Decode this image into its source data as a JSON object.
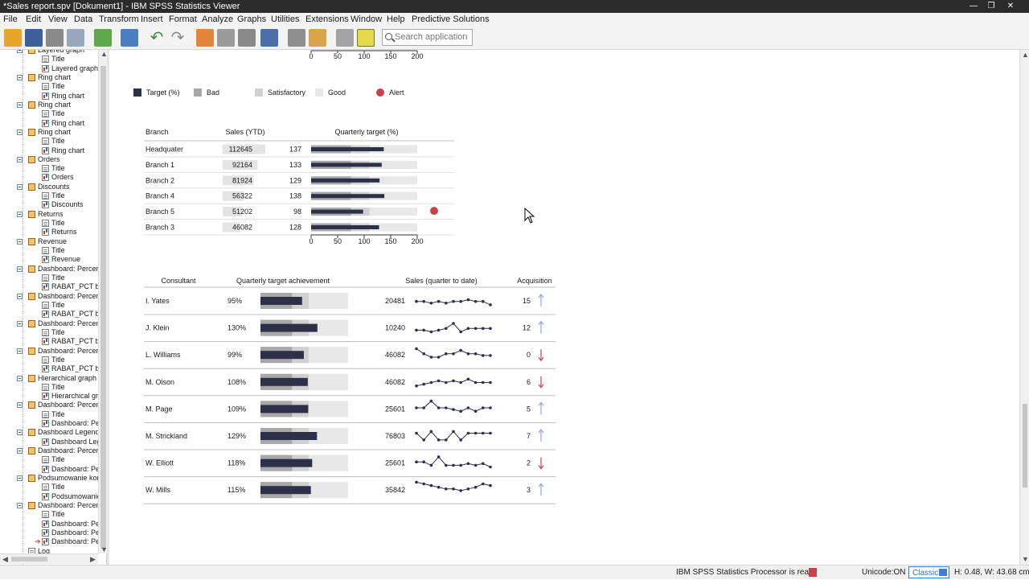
{
  "window": {
    "title": "*Sales report.spv [Dokument1] - IBM SPSS Statistics Viewer",
    "controls": [
      "—",
      "❐",
      "✕"
    ]
  },
  "menu": [
    "File",
    "Edit",
    "View",
    "Data",
    "Transform",
    "Insert",
    "Format",
    "Analyze",
    "Graphs",
    "Utilities",
    "Extensions",
    "Window",
    "Help",
    "Predictive Solutions"
  ],
  "toolbar": {
    "search_placeholder": "Search application",
    "icons": [
      "open-icon",
      "save-icon",
      "print-icon",
      "print-preview-icon",
      "export-icon",
      "recall-dialog-icon",
      "undo-icon",
      "redo-icon",
      "goto-data-icon",
      "goto-case-icon",
      "goto-variable-icon",
      "variables-icon",
      "designate-window-icon",
      "insert-output-icon",
      "hide-icon",
      "promote-icon",
      "demote-icon",
      "new-item-icon"
    ]
  },
  "outline": {
    "items": [
      {
        "level": 1,
        "type": "book",
        "label": "Layered graph"
      },
      {
        "level": 2,
        "type": "page",
        "label": "Title"
      },
      {
        "level": 2,
        "type": "graph",
        "label": "Layered graph"
      },
      {
        "level": 1,
        "type": "book",
        "label": "Ring chart"
      },
      {
        "level": 2,
        "type": "page",
        "label": "Title"
      },
      {
        "level": 2,
        "type": "graph",
        "label": "Ring chart"
      },
      {
        "level": 1,
        "type": "book",
        "label": "Ring chart"
      },
      {
        "level": 2,
        "type": "page",
        "label": "Title"
      },
      {
        "level": 2,
        "type": "graph",
        "label": "Ring chart"
      },
      {
        "level": 1,
        "type": "book",
        "label": "Ring chart"
      },
      {
        "level": 2,
        "type": "page",
        "label": "Title"
      },
      {
        "level": 2,
        "type": "graph",
        "label": "Ring chart"
      },
      {
        "level": 1,
        "type": "book",
        "label": "Orders"
      },
      {
        "level": 2,
        "type": "page",
        "label": "Title"
      },
      {
        "level": 2,
        "type": "graph",
        "label": "Orders"
      },
      {
        "level": 1,
        "type": "book",
        "label": "Discounts"
      },
      {
        "level": 2,
        "type": "page",
        "label": "Title"
      },
      {
        "level": 2,
        "type": "graph",
        "label": "Discounts"
      },
      {
        "level": 1,
        "type": "book",
        "label": "Returns"
      },
      {
        "level": 2,
        "type": "page",
        "label": "Title"
      },
      {
        "level": 2,
        "type": "graph",
        "label": "Returns"
      },
      {
        "level": 1,
        "type": "book",
        "label": "Revenue"
      },
      {
        "level": 2,
        "type": "page",
        "label": "Title"
      },
      {
        "level": 2,
        "type": "graph",
        "label": "Revenue"
      },
      {
        "level": 1,
        "type": "book",
        "label": "Dashboard: Percenta"
      },
      {
        "level": 2,
        "type": "page",
        "label": "Title"
      },
      {
        "level": 2,
        "type": "graph",
        "label": "RABAT_PCT by"
      },
      {
        "level": 1,
        "type": "book",
        "label": "Dashboard: Percenta"
      },
      {
        "level": 2,
        "type": "page",
        "label": "Title"
      },
      {
        "level": 2,
        "type": "graph",
        "label": "RABAT_PCT by"
      },
      {
        "level": 1,
        "type": "book",
        "label": "Dashboard: Percenta"
      },
      {
        "level": 2,
        "type": "page",
        "label": "Title"
      },
      {
        "level": 2,
        "type": "graph",
        "label": "RABAT_PCT by"
      },
      {
        "level": 1,
        "type": "book",
        "label": "Dashboard: Percenta"
      },
      {
        "level": 2,
        "type": "page",
        "label": "Title"
      },
      {
        "level": 2,
        "type": "graph",
        "label": "RABAT_PCT by"
      },
      {
        "level": 1,
        "type": "book",
        "label": "Hierarchical graph"
      },
      {
        "level": 2,
        "type": "page",
        "label": "Title"
      },
      {
        "level": 2,
        "type": "graph",
        "label": "Hierarchical gra"
      },
      {
        "level": 1,
        "type": "book",
        "label": "Dashboard: Percenta"
      },
      {
        "level": 2,
        "type": "page",
        "label": "Title"
      },
      {
        "level": 2,
        "type": "graph",
        "label": "Dashboard: Per"
      },
      {
        "level": 1,
        "type": "book",
        "label": "Dashboard Legend"
      },
      {
        "level": 2,
        "type": "graph",
        "label": "Dashboard Lege"
      },
      {
        "level": 1,
        "type": "book",
        "label": "Dashboard: Percenta"
      },
      {
        "level": 2,
        "type": "page",
        "label": "Title"
      },
      {
        "level": 2,
        "type": "graph",
        "label": "Dashboard: Per"
      },
      {
        "level": 1,
        "type": "book",
        "label": "Podsumowanie kons"
      },
      {
        "level": 2,
        "type": "page",
        "label": "Title"
      },
      {
        "level": 2,
        "type": "graph",
        "label": "Podsumowanie"
      },
      {
        "level": 1,
        "type": "book",
        "label": "Dashboard: Percenta"
      },
      {
        "level": 2,
        "type": "page",
        "label": "Title"
      },
      {
        "level": 2,
        "type": "graph",
        "label": "Dashboard: Per"
      },
      {
        "level": 2,
        "type": "graph",
        "label": "Dashboard: Per"
      },
      {
        "level": 2,
        "type": "graph",
        "label": "Dashboard: Per",
        "current": true
      },
      {
        "level": 0,
        "type": "log",
        "label": "Log"
      }
    ]
  },
  "colors": {
    "target": "#2e2f48",
    "bad": "#a8a8a8",
    "satisfactory": "#d0d0d0",
    "good": "#e8e8e8",
    "alert": "#c8414b",
    "arrow_up": "#8fa8d8",
    "arrow_down": "#c8414b"
  },
  "top_axis_ticks": [
    "0",
    "50",
    "100",
    "150",
    "200"
  ],
  "legend": [
    {
      "label": "Target (%)",
      "color": "#2e2f48"
    },
    {
      "label": "Bad",
      "color": "#a8a8a8"
    },
    {
      "label": "Satisfactory",
      "color": "#d0d0d0"
    },
    {
      "label": "Good",
      "color": "#e8e8e8"
    },
    {
      "label": "Alert",
      "color": "#c8414b",
      "shape": "circle"
    }
  ],
  "branch_table": {
    "headers": [
      "Branch",
      "Sales (YTD)",
      "Quarterly target (%)"
    ],
    "axis_ticks": [
      "0",
      "50",
      "100",
      "150",
      "200"
    ],
    "rows": [
      {
        "branch": "Headquater",
        "sales": "112645",
        "pct": "137",
        "pct_value": 137,
        "sales_value": 112645,
        "alert": false
      },
      {
        "branch": "Branch 1",
        "sales": "92164",
        "pct": "133",
        "pct_value": 133,
        "sales_value": 92164,
        "alert": false
      },
      {
        "branch": "Branch 2",
        "sales": "81924",
        "pct": "129",
        "pct_value": 129,
        "sales_value": 81924,
        "alert": false
      },
      {
        "branch": "Branch 4",
        "sales": "56322",
        "pct": "138",
        "pct_value": 138,
        "sales_value": 56322,
        "alert": false
      },
      {
        "branch": "Branch 5",
        "sales": "51202",
        "pct": "98",
        "pct_value": 98,
        "sales_value": 51202,
        "alert": true
      },
      {
        "branch": "Branch 3",
        "sales": "46082",
        "pct": "128",
        "pct_value": 128,
        "sales_value": 46082,
        "alert": false
      }
    ]
  },
  "consultant_table": {
    "headers": [
      "Consultant",
      "Quarterly target achievement",
      "Sales (quarter to date)",
      "Acquisition"
    ],
    "rows": [
      {
        "name": "I. Yates",
        "pct": "95%",
        "pct_value": 95,
        "sales": "20481",
        "acq": "15",
        "trend": "up",
        "spark": [
          3,
          3,
          2,
          3,
          2,
          3,
          3,
          4,
          3,
          3,
          1
        ]
      },
      {
        "name": "J. Klein",
        "pct": "130%",
        "pct_value": 130,
        "sales": "10240",
        "acq": "12",
        "trend": "up",
        "spark": [
          2,
          2,
          1,
          2,
          3,
          6,
          1,
          3,
          3,
          3,
          3
        ]
      },
      {
        "name": "L. Williams",
        "pct": "99%",
        "pct_value": 99,
        "sales": "46082",
        "acq": "0",
        "trend": "down",
        "spark": [
          7,
          4,
          2,
          2,
          4,
          4,
          6,
          4,
          4,
          3,
          3
        ]
      },
      {
        "name": "M. Olson",
        "pct": "108%",
        "pct_value": 108,
        "sales": "46082",
        "acq": "6",
        "trend": "down",
        "spark": [
          1,
          2,
          3,
          4,
          3,
          4,
          3,
          5,
          3,
          3,
          3
        ]
      },
      {
        "name": "M. Page",
        "pct": "109%",
        "pct_value": 109,
        "sales": "25601",
        "acq": "5",
        "trend": "up",
        "spark": [
          4,
          4,
          8,
          4,
          4,
          3,
          2,
          4,
          2,
          4,
          4
        ]
      },
      {
        "name": "M. Strickland",
        "pct": "129%",
        "pct_value": 129,
        "sales": "76803",
        "acq": "7",
        "trend": "up",
        "spark": [
          5,
          1,
          6,
          1,
          1,
          6,
          1,
          5,
          5,
          5,
          5
        ]
      },
      {
        "name": "W. Elliott",
        "pct": "118%",
        "pct_value": 118,
        "sales": "25601",
        "acq": "2",
        "trend": "down",
        "spark": [
          4,
          4,
          2,
          7,
          2,
          2,
          2,
          3,
          2,
          3,
          1
        ]
      },
      {
        "name": "W. Mills",
        "pct": "115%",
        "pct_value": 115,
        "sales": "35842",
        "acq": "3",
        "trend": "up",
        "spark": [
          8,
          7,
          6,
          5,
          4,
          4,
          3,
          4,
          5,
          7,
          6
        ]
      }
    ]
  },
  "status": {
    "processor": "IBM SPSS Statistics Processor is ready",
    "unicode": "Unicode:ON",
    "mode": "Classic",
    "dimensions": "H: 0.48, W: 43.68 cm"
  }
}
